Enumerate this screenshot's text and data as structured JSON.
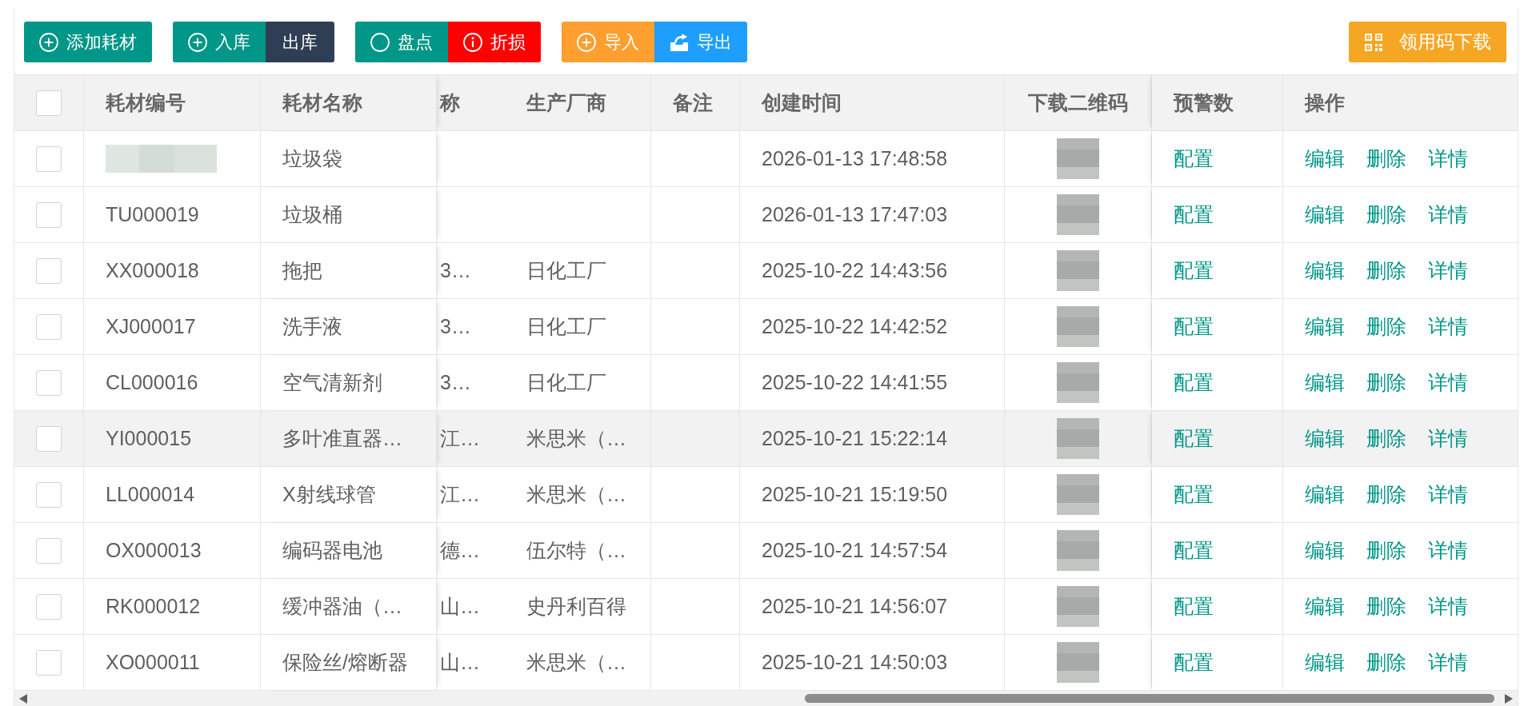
{
  "toolbar": {
    "groups": [
      {
        "buttons": [
          {
            "kind": "plus",
            "label": "添加耗材",
            "color": "#009688"
          }
        ]
      },
      {
        "buttons": [
          {
            "kind": "plus",
            "label": "入库",
            "color": "#009688"
          },
          {
            "kind": "text",
            "label": "出库",
            "color": "#2f3e55"
          }
        ]
      },
      {
        "buttons": [
          {
            "kind": "ring",
            "label": "盘点",
            "color": "#009688"
          },
          {
            "kind": "info",
            "label": "折损",
            "color": "#ff0000"
          }
        ]
      },
      {
        "buttons": [
          {
            "kind": "plus",
            "label": "导入",
            "color": "#ff9f30"
          },
          {
            "kind": "export",
            "label": "导出",
            "color": "#1e9fff"
          }
        ]
      }
    ],
    "download_button": {
      "kind": "qrcode",
      "label": "领用码下载",
      "color": "#f5a623"
    }
  },
  "table": {
    "select_all": {
      "checked": false
    },
    "columns": [
      "耗材编号",
      "耗材名称",
      "称",
      "生产厂商",
      "备注",
      "创建时间",
      "下载二维码",
      "预警数",
      "操作"
    ],
    "rows": [
      {
        "checked": false,
        "hovered": false,
        "code_blurred": true,
        "name": "垃圾袋",
        "created": "2026-01-13 17:48:58",
        "warning_link": "配置",
        "actions": [
          "编辑",
          "删除",
          "详情"
        ]
      },
      {
        "checked": false,
        "hovered": false,
        "code_blurred": false,
        "code": "TU000019",
        "name": "垃圾桶",
        "created": "2026-01-13 17:47:03",
        "warning_link": "配置",
        "actions": [
          "编辑",
          "删除",
          "详情"
        ]
      },
      {
        "checked": false,
        "hovered": false,
        "code_blurred": false,
        "code": "XX000018",
        "name": "拖把",
        "column_3": "3…",
        "manufacturer": "日化工厂",
        "created": "2025-10-22 14:43:56",
        "warning_link": "配置",
        "actions": [
          "编辑",
          "删除",
          "详情"
        ]
      },
      {
        "checked": false,
        "hovered": false,
        "code_blurred": false,
        "code": "XJ000017",
        "name": "洗手液",
        "column_3": "3…",
        "manufacturer": "日化工厂",
        "created": "2025-10-22 14:42:52",
        "warning_link": "配置",
        "actions": [
          "编辑",
          "删除",
          "详情"
        ]
      },
      {
        "checked": false,
        "hovered": false,
        "code_blurred": false,
        "code": "CL000016",
        "name": "空气清新剂",
        "column_3": "3…",
        "manufacturer": "日化工厂",
        "created": "2025-10-22 14:41:55",
        "warning_link": "配置",
        "actions": [
          "编辑",
          "删除",
          "详情"
        ]
      },
      {
        "checked": false,
        "hovered": true,
        "code_blurred": false,
        "code": "YI000015",
        "name": "多叶准直器…",
        "column_3": "江…",
        "manufacturer": "米思米（…",
        "created": "2025-10-21 15:22:14",
        "warning_link": "配置",
        "actions": [
          "编辑",
          "删除",
          "详情"
        ]
      },
      {
        "checked": false,
        "hovered": false,
        "code_blurred": false,
        "code": "LL000014",
        "name": "X射线球管",
        "column_3": "江…",
        "manufacturer": "米思米（…",
        "created": "2025-10-21 15:19:50",
        "warning_link": "配置",
        "actions": [
          "编辑",
          "删除",
          "详情"
        ]
      },
      {
        "checked": false,
        "hovered": false,
        "code_blurred": false,
        "code": "OX000013",
        "name": "编码器电池",
        "column_3": "德…",
        "manufacturer": "伍尔特（…",
        "created": "2025-10-21 14:57:54",
        "warning_link": "配置",
        "actions": [
          "编辑",
          "删除",
          "详情"
        ]
      },
      {
        "checked": false,
        "hovered": false,
        "code_blurred": false,
        "code": "RK000012",
        "name": "缓冲器油（…",
        "column_3": "山…",
        "manufacturer": "史丹利百得",
        "created": "2025-10-21 14:56:07",
        "warning_link": "配置",
        "actions": [
          "编辑",
          "删除",
          "详情"
        ]
      },
      {
        "checked": false,
        "hovered": false,
        "code_blurred": false,
        "code": "XO000011",
        "name": "保险丝/熔断器",
        "column_3": "山…",
        "manufacturer": "米思米（…",
        "created": "2025-10-21 14:50:03",
        "warning_link": "配置",
        "actions": [
          "编辑",
          "删除",
          "详情"
        ]
      }
    ]
  }
}
